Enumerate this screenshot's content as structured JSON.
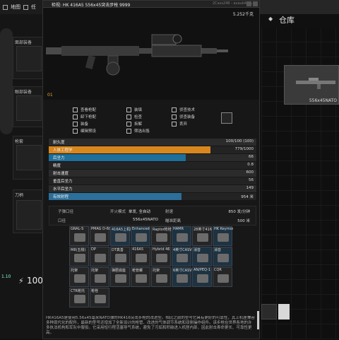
{
  "nav": {
    "tab1": "地图",
    "tab2": "任"
  },
  "left": {
    "headwear": "面部装备",
    "eyewear": "眼部装备",
    "holster": "枪套",
    "melee": "刀柄",
    "stat_small": "1.10",
    "money": "100"
  },
  "warehouse": {
    "title": "仓库",
    "item_label": "556x45NATO"
  },
  "window": {
    "title": "检视: HK 416A5 556x45突击步枪 9999",
    "id": "2Cass248 - avaub4MA",
    "weight": "5.252千克",
    "found_badge": "01"
  },
  "actions": [
    {
      "label": "查看枪配",
      "icon": "grid-icon"
    },
    {
      "label": "装填",
      "icon": "wrench-icon"
    },
    {
      "label": "侦查技术",
      "icon": "nodes-icon"
    },
    {
      "label": "卸下枪配",
      "icon": "grid-icon"
    },
    {
      "label": "检查",
      "icon": "shield-icon"
    },
    {
      "label": "侦查装备",
      "icon": "nodes-icon"
    },
    {
      "label": "装备",
      "icon": "crown-icon"
    },
    {
      "label": "拆解",
      "icon": "wrench-icon"
    },
    {
      "label": "丢弃",
      "icon": "crown-icon"
    },
    {
      "label": "编辑预设",
      "icon": "crown-icon"
    },
    {
      "label": "筛选出售",
      "icon": "search-icon"
    }
  ],
  "stats": [
    {
      "label": "耐久度",
      "value": "100/100 (100)",
      "fill": 0.0,
      "color": "#6a6a6a"
    },
    {
      "label": "人体工程学",
      "value": "779/1000",
      "fill": 0.78,
      "color": "#d8871e"
    },
    {
      "label": "后坐力",
      "value": "66",
      "fill": 0.66,
      "color": "#1e6f9a"
    },
    {
      "label": "精度",
      "value": "0.8",
      "fill": 0.0,
      "color": "#6a6a6a"
    },
    {
      "label": "射击速度",
      "value": "600",
      "fill": 0.0,
      "color": "#6a6a6a"
    },
    {
      "label": "垂直后坐力",
      "value": "56",
      "fill": 0.0,
      "color": "#6a6a6a"
    },
    {
      "label": "水平后坐力",
      "value": "149",
      "fill": 0.0,
      "color": "#6a6a6a"
    },
    {
      "label": "有效射程",
      "value": "954 米",
      "fill": 0.64,
      "color": "#2b6f9a"
    }
  ],
  "info": {
    "caliber_label": "子弹口径",
    "firemode_label": "开火模式",
    "firemode_value": "单发, 全自动",
    "fire_label": "射速",
    "fire_value": "850 发/分钟",
    "ammo_label": "口径",
    "ammo_value": "556x45NATO",
    "range_label": "瞄准距离",
    "range_value": "500 米"
  },
  "mods": [
    {
      "label": "GRAL-S",
      "style": "dark"
    },
    {
      "label": "PMAG D-60",
      "style": "dark"
    },
    {
      "label": "416A5上机匣",
      "style": "blue"
    },
    {
      "label": "Enhanced",
      "style": "blue"
    },
    {
      "label": "Raptor枪栓",
      "style": "dark"
    },
    {
      "label": "HAMR",
      "style": "blue"
    },
    {
      "label": "28英寸416",
      "style": "dark"
    },
    {
      "label": "HK Keymod",
      "style": "blue"
    },
    {
      "label": "M8(五梭)",
      "style": "dark"
    },
    {
      "label": "DP",
      "style": "dark"
    },
    {
      "label": "DT真善",
      "style": "dark"
    },
    {
      "label": "416A5",
      "style": "dark"
    },
    {
      "label": "Hybrid 46",
      "style": "dark"
    },
    {
      "label": "4英寸CASV",
      "style": "blue"
    },
    {
      "label": "消音",
      "style": "blue"
    },
    {
      "label": "消音",
      "style": "blue"
    },
    {
      "label": "托架",
      "style": "dark"
    },
    {
      "label": "托架",
      "style": "dark"
    },
    {
      "label": "弹匣底座",
      "style": "dark"
    },
    {
      "label": "枪管螺",
      "style": "dark"
    },
    {
      "label": "托架",
      "style": "dark"
    },
    {
      "label": "6英寸CASV",
      "style": "blue"
    },
    {
      "label": "AN/PEQ-1",
      "style": "blue"
    },
    {
      "label": "CQR",
      "style": "dark"
    },
    {
      "label": "CTR枪托",
      "style": "dark"
    },
    {
      "label": "枪栓",
      "style": "dark"
    }
  ],
  "description": "HK416A5是使用5.56x45毫米NATO弹的HK416突击步枪的改进型。相比之前的型号它具有更好的可靠性，其上机匣兼容多种现代化的配件，最新的型号还增加了全新设计的枪管、改进的气体调节系统和双侧操作组件。该步枪在世界各地的许多执法机构和军队中服役。它采用短行程活塞导气系统，避免了污垢和积碳进入机匣内部，因此射击寿命更长、可靠性更高。"
}
